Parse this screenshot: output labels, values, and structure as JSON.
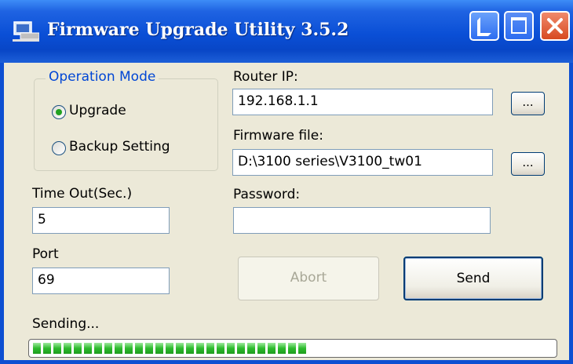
{
  "window": {
    "title": "Firmware Upgrade Utility 3.5.2",
    "title_bar_color": "#0a4fd6"
  },
  "operation_mode": {
    "label": "Operation Mode",
    "options": [
      {
        "label": "Upgrade",
        "selected": true
      },
      {
        "label": "Backup Setting",
        "selected": false
      }
    ]
  },
  "fields": {
    "router_ip_label": "Router IP:",
    "router_ip_value": "192.168.1.1",
    "firmware_file_label": "Firmware file:",
    "firmware_file_value": "D:\\3100 series\\V3100_tw01",
    "password_label": "Password:",
    "password_value": "",
    "timeout_label": "Time Out(Sec.)",
    "timeout_value": "5",
    "port_label": "Port",
    "port_value": "69"
  },
  "buttons": {
    "browse_label": "...",
    "abort_label": "Abort",
    "send_label": "Send"
  },
  "status": {
    "text": "Sending...",
    "progress_percent": 53,
    "progress_color": "#2dbb2d"
  }
}
